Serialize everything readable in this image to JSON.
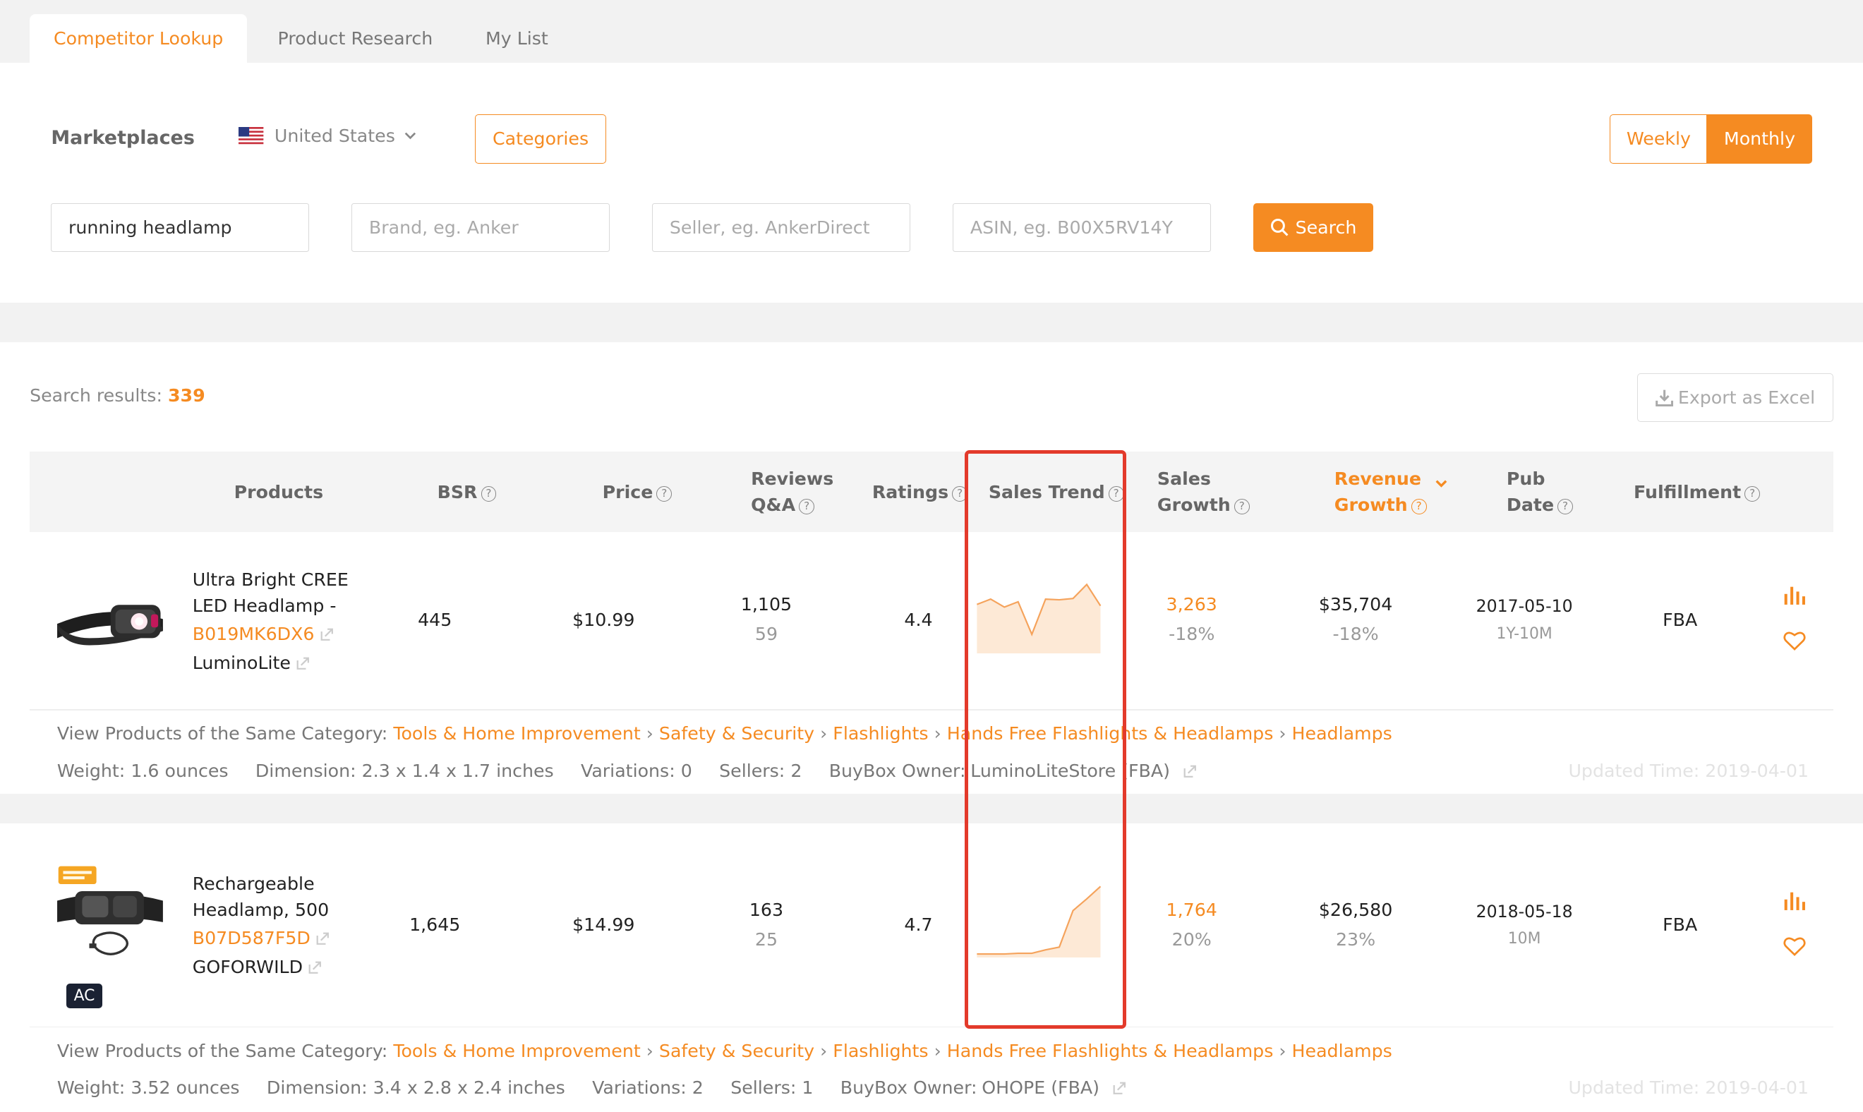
{
  "tabs": [
    {
      "label": "Competitor Lookup",
      "active": true
    },
    {
      "label": "Product Research"
    },
    {
      "label": "My List"
    }
  ],
  "filters": {
    "marketplaces_label": "Marketplaces",
    "country": "United States",
    "categories_label": "Categories",
    "period": {
      "weekly": "Weekly",
      "monthly": "Monthly",
      "selected": "Monthly"
    },
    "keyword_value": "running headlamp",
    "brand_placeholder": "Brand, eg. Anker",
    "seller_placeholder": "Seller, eg. AnkerDirect",
    "asin_placeholder": "ASIN, eg. B00X5RV14Y",
    "search_label": "Search"
  },
  "results": {
    "label": "Search results:",
    "count": "339",
    "export_label": "Export as Excel"
  },
  "columns": {
    "products": "Products",
    "bsr": "BSR",
    "price": "Price",
    "reviews_l1": "Reviews",
    "reviews_l2": "Q&A",
    "ratings": "Ratings",
    "sales_trend": "Sales Trend",
    "sales_growth_l1": "Sales",
    "sales_growth_l2": "Growth",
    "revenue_growth_l1": "Revenue",
    "revenue_growth_l2": "Growth",
    "pub_date_l1": "Pub",
    "pub_date_l2": "Date",
    "fulfillment": "Fulfillment"
  },
  "colors": {
    "accent": "#f58b22",
    "highlight": "#e33a2b"
  },
  "products": [
    {
      "title_l1": "Ultra Bright CREE",
      "title_l2": "LED Headlamp -",
      "asin": "B019MK6DX6",
      "brand": "LuminoLite",
      "bsr": "445",
      "price": "$10.99",
      "reviews": "1,105",
      "qa": "59",
      "rating": "4.4",
      "sales": "3,263",
      "sales_growth": "-18%",
      "revenue": "$35,704",
      "revenue_growth": "-18%",
      "pub_date": "2017-05-10",
      "age": "1Y-10M",
      "fulfillment": "FBA",
      "trend": [
        0.7,
        0.78,
        0.66,
        0.74,
        0.25,
        0.78,
        0.77,
        0.79,
        1.0,
        0.68
      ],
      "category_label": "View Products of the Same Category:",
      "category_path": [
        "Tools & Home Improvement",
        "Safety & Security",
        "Flashlights",
        "Hands Free Flashlights & Headlamps",
        "Headlamps"
      ],
      "weight": "Weight: 1.6 ounces",
      "dimension": "Dimension: 2.3 x 1.4 x 1.7 inches",
      "variations": "Variations: 0",
      "sellers": "Sellers: 2",
      "buybox_label": "BuyBox Owner:",
      "buybox": "LuminoLiteStore (FBA)",
      "updated": "Updated Time: 2019-04-01"
    },
    {
      "title_l1": "Rechargeable",
      "title_l2": "Headlamp, 500",
      "asin": "B07D587F5D",
      "brand": "GOFORWILD",
      "badge": "AC",
      "bsr": "1,645",
      "price": "$14.99",
      "reviews": "163",
      "qa": "25",
      "rating": "4.7",
      "sales": "1,764",
      "sales_growth": "20%",
      "revenue": "$26,580",
      "revenue_growth": "23%",
      "pub_date": "2018-05-18",
      "age": "10M",
      "fulfillment": "FBA",
      "trend": [
        0.02,
        0.02,
        0.02,
        0.03,
        0.03,
        0.08,
        0.12,
        0.65,
        0.82,
        1.0
      ],
      "category_label": "View Products of the Same Category:",
      "category_path": [
        "Tools & Home Improvement",
        "Safety & Security",
        "Flashlights",
        "Hands Free Flashlights & Headlamps",
        "Headlamps"
      ],
      "weight": "Weight: 3.52 ounces",
      "dimension": "Dimension: 3.4 x 2.8 x 2.4 inches",
      "variations": "Variations: 2",
      "sellers": "Sellers: 1",
      "buybox_label": "BuyBox Owner:",
      "buybox": "OHOPE (FBA)",
      "updated": "Updated Time: 2019-04-01"
    }
  ]
}
